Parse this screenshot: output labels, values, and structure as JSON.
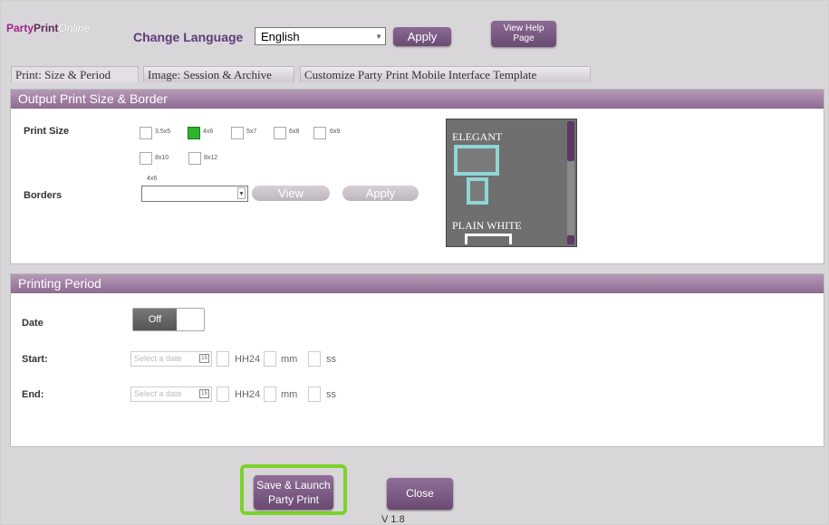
{
  "header": {
    "logo": {
      "part1": "Party",
      "part2": "Print",
      "part3": "Online"
    },
    "change_language_label": "Change Language",
    "language_value": "English",
    "apply_label": "Apply",
    "help_label_line1": "View Help",
    "help_label_line2": "Page"
  },
  "tabs": [
    {
      "label": "Print: Size & Period"
    },
    {
      "label": "Image: Session & Archive"
    },
    {
      "label": "Customize Party Print Mobile Interface Template"
    }
  ],
  "output_panel": {
    "title": "Output Print Size & Border",
    "print_size_label": "Print Size",
    "sizes": [
      {
        "label": "3.5x5",
        "checked": false
      },
      {
        "label": "4x6",
        "checked": true
      },
      {
        "label": "5x7",
        "checked": false
      },
      {
        "label": "6x8",
        "checked": false
      },
      {
        "label": "6x9",
        "checked": false
      },
      {
        "label": "8x10",
        "checked": false
      },
      {
        "label": "8x12",
        "checked": false
      }
    ],
    "borders_size_label": "4x6",
    "borders_label": "Borders",
    "view_label": "View",
    "apply_label": "Apply",
    "preview": {
      "elegant_label": "ELEGANT",
      "plain_label": "PLAIN WHITE"
    }
  },
  "period_panel": {
    "title": "Printing Period",
    "date_label": "Date",
    "toggle_value": "Off",
    "start_label": "Start:",
    "end_label": "End:",
    "date_placeholder": "Select a date",
    "hh_unit": "HH24",
    "mm_unit": "mm",
    "ss_unit": "ss"
  },
  "footer": {
    "save_label_line1": "Save & Launch",
    "save_label_line2": "Party Print",
    "close_label": "Close",
    "version": "V 1.8"
  },
  "colors": {
    "accent": "#7a5a82",
    "panel_header": "#a07fa3",
    "highlight": "#7bd32a",
    "checked": "#2bb52e"
  }
}
